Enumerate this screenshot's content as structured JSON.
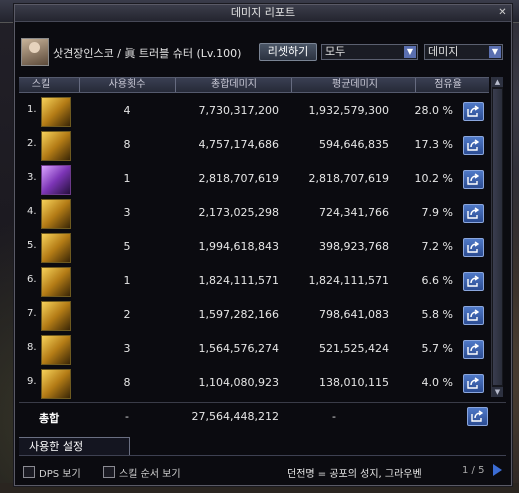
{
  "window": {
    "title": "데미지 리포트",
    "close_glyph": "✕"
  },
  "header": {
    "player_name": "삿견장인스코 / 眞 트러블 슈터 (Lv.100)",
    "reset_label": "리셋하기",
    "filter_select": "모두",
    "metric_select": "데미지"
  },
  "table": {
    "columns": {
      "skill": "스킬",
      "count": "사용횟수",
      "total": "총합데미지",
      "avg": "평균데미지",
      "pct": "점유율"
    },
    "rows": [
      {
        "rank": "1.",
        "count": "4",
        "total": "7,730,317,200",
        "avg": "1,932,579,300",
        "pct": "28.0 %",
        "icon": "golden-fist-skill-icon"
      },
      {
        "rank": "2.",
        "count": "8",
        "total": "4,757,174,686",
        "avg": "594,646,835",
        "pct": "17.3 %",
        "icon": "golden-blade-skill-icon"
      },
      {
        "rank": "3.",
        "count": "1",
        "total": "2,818,707,619",
        "avg": "2,818,707,619",
        "pct": "10.2 %",
        "icon": "purple-burst-skill-icon"
      },
      {
        "rank": "4.",
        "count": "3",
        "total": "2,173,025,298",
        "avg": "724,341,766",
        "pct": "7.9 %",
        "icon": "golden-wave-skill-icon"
      },
      {
        "rank": "5.",
        "count": "5",
        "total": "1,994,618,843",
        "avg": "398,923,768",
        "pct": "7.2 %",
        "icon": "golden-spark-skill-icon"
      },
      {
        "rank": "6.",
        "count": "1",
        "total": "1,824,111,571",
        "avg": "1,824,111,571",
        "pct": "6.6 %",
        "icon": "golden-shield-skill-icon"
      },
      {
        "rank": "7.",
        "count": "2",
        "total": "1,597,282,166",
        "avg": "798,641,083",
        "pct": "5.8 %",
        "icon": "golden-slash-skill-icon"
      },
      {
        "rank": "8.",
        "count": "3",
        "total": "1,564,576,274",
        "avg": "521,525,424",
        "pct": "5.7 %",
        "icon": "golden-star-skill-icon"
      },
      {
        "rank": "9.",
        "count": "8",
        "total": "1,104,080,923",
        "avg": "138,010,115",
        "pct": "4.0 %",
        "icon": "golden-orb-skill-icon"
      }
    ],
    "total_row": {
      "label": "총합",
      "count": "-",
      "total": "27,564,448,212",
      "avg": "-"
    }
  },
  "tabs": {
    "used_settings": "사용한 설정"
  },
  "footer": {
    "dps_label": "DPS 보기",
    "order_label": "스킬 순서 보기",
    "dungeon": "던전명 = 공포의 성지, 그라우벤",
    "pager": "1 / 5"
  },
  "colors": {
    "share_button": "#3b63b3",
    "accent_blue": "#3b6cd4"
  }
}
